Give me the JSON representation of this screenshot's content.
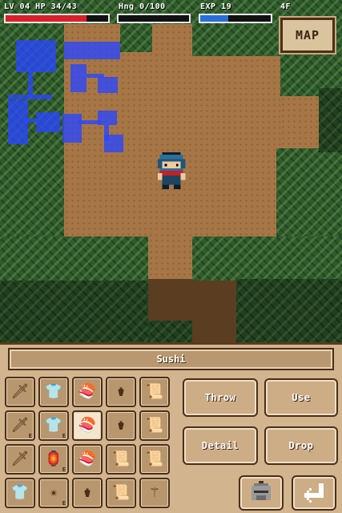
{
  "hud": {
    "level_hp": "LV 04 HP 34/43",
    "hunger": "Hng 0/100",
    "exp": "EXP 19",
    "floor": "4F",
    "hp_fraction": 0.79,
    "hunger_fraction": 0.0,
    "exp_fraction": 0.4,
    "map_button": "MAP"
  },
  "colors": {
    "hp_bar": "#d8202a",
    "hunger_bar": "#3c3c3c",
    "exp_bar": "#2a6fd8",
    "minimap": "#2846ff"
  },
  "inventory": {
    "selected_item_name": "Sushi",
    "slots": [
      {
        "icon": "sword-icon",
        "glyph": "🗡",
        "equipped": false
      },
      {
        "icon": "armor-icon",
        "glyph": "👕",
        "equipped": false
      },
      {
        "icon": "sushi-icon",
        "glyph": "🍣",
        "equipped": false
      },
      {
        "icon": "pot-icon",
        "glyph": "⚱",
        "equipped": false
      },
      {
        "icon": "scroll-icon",
        "glyph": "📜",
        "equipped": false
      },
      {
        "icon": "sword-icon",
        "glyph": "🗡",
        "equipped": true
      },
      {
        "icon": "armor-icon",
        "glyph": "👕",
        "equipped": true
      },
      {
        "icon": "sushi-icon",
        "glyph": "🍣",
        "equipped": false
      },
      {
        "icon": "pot-icon",
        "glyph": "⚱",
        "equipped": false
      },
      {
        "icon": "scroll-icon",
        "glyph": "📜",
        "equipped": false
      },
      {
        "icon": "sword-icon",
        "glyph": "🗡",
        "equipped": false
      },
      {
        "icon": "lantern-icon",
        "glyph": "🏮",
        "equipped": true
      },
      {
        "icon": "sushi-icon",
        "glyph": "🍣",
        "equipped": false
      },
      {
        "icon": "scroll-icon",
        "glyph": "📜",
        "equipped": false
      },
      {
        "icon": "scroll-icon",
        "glyph": "📜",
        "equipped": false
      },
      {
        "icon": "armor-icon",
        "glyph": "👕",
        "equipped": false
      },
      {
        "icon": "shuriken-icon",
        "glyph": "✴",
        "equipped": true
      },
      {
        "icon": "pot-icon",
        "glyph": "⚱",
        "equipped": false
      },
      {
        "icon": "scroll-icon",
        "glyph": "📜",
        "equipped": false
      },
      {
        "icon": "staff-icon",
        "glyph": "⚚",
        "equipped": false
      }
    ],
    "selected_index": 7,
    "equipped_mark": "E"
  },
  "actions": {
    "throw": "Throw",
    "use": "Use",
    "detail": "Detail",
    "drop": "Drop"
  }
}
